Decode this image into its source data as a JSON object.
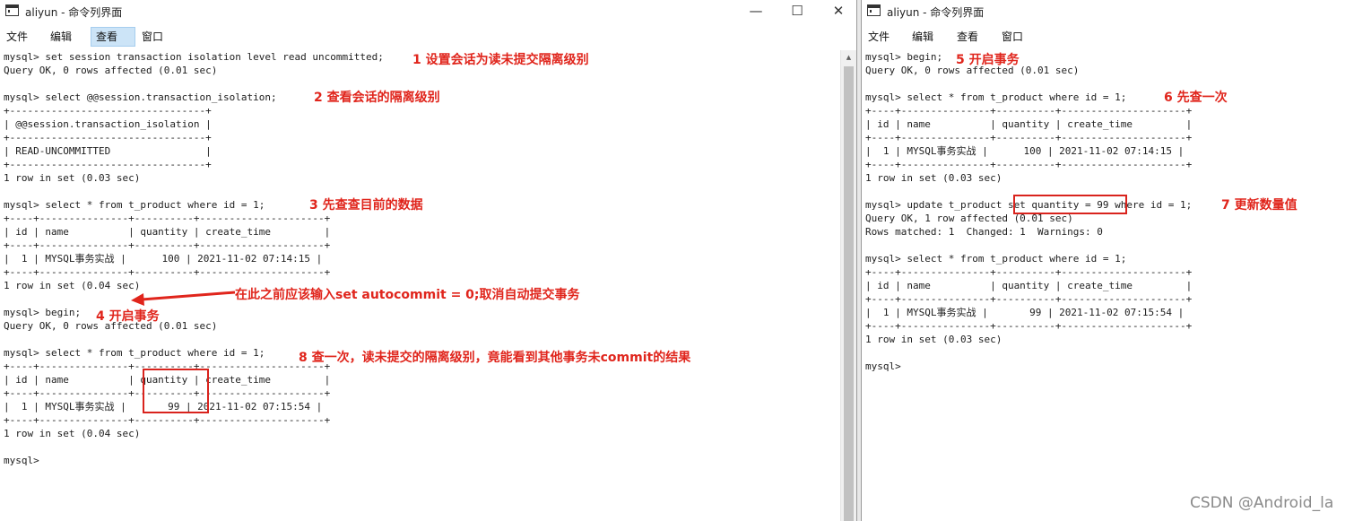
{
  "left_window": {
    "title": "aliyun - 命令列界面",
    "menu": [
      "文件",
      "编辑",
      "查看",
      "窗口"
    ],
    "active_menu_index": 2,
    "window_controls": [
      "—",
      "☐",
      "✕"
    ],
    "lines": [
      "mysql> set session transaction isolation level read uncommitted;",
      "Query OK, 0 rows affected (0.01 sec)",
      "",
      "mysql> select @@session.transaction_isolation;",
      "+---------------------------------+",
      "| @@session.transaction_isolation |",
      "+---------------------------------+",
      "| READ-UNCOMMITTED                |",
      "+---------------------------------+",
      "1 row in set (0.03 sec)",
      "",
      "mysql> select * from t_product where id = 1;",
      "+----+---------------+----------+---------------------+",
      "| id | name          | quantity | create_time         |",
      "+----+---------------+----------+---------------------+",
      "|  1 | MYSQL事务实战 |      100 | 2021-11-02 07:14:15 |",
      "+----+---------------+----------+---------------------+",
      "1 row in set (0.04 sec)",
      "",
      "mysql> begin;",
      "Query OK, 0 rows affected (0.01 sec)",
      "",
      "mysql> select * from t_product where id = 1;",
      "+----+---------------+----------+---------------------+",
      "| id | name          | quantity | create_time         |",
      "+----+---------------+----------+---------------------+",
      "|  1 | MYSQL事务实战 |       99 | 2021-11-02 07:15:54 |",
      "+----+---------------+----------+---------------------+",
      "1 row in set (0.04 sec)",
      "",
      "mysql>"
    ],
    "annotations": [
      "1 设置会话为读未提交隔离级别",
      "2 查看会话的隔离级别",
      "3 先查查目前的数据",
      "在此之前应该输入set autocommit = 0;取消自动提交事务",
      "4 开启事务",
      "8 查一次，读未提交的隔离级别，竟能看到其他事务未commit的结果"
    ]
  },
  "right_window": {
    "title": "aliyun - 命令列界面",
    "menu": [
      "文件",
      "编辑",
      "查看",
      "窗口"
    ],
    "lines": [
      "mysql> begin;",
      "Query OK, 0 rows affected (0.01 sec)",
      "",
      "mysql> select * from t_product where id = 1;",
      "+----+---------------+----------+---------------------+",
      "| id | name          | quantity | create_time         |",
      "+----+---------------+----------+---------------------+",
      "|  1 | MYSQL事务实战 |      100 | 2021-11-02 07:14:15 |",
      "+----+---------------+----------+---------------------+",
      "1 row in set (0.03 sec)",
      "",
      "mysql> update t_product set quantity = 99 where id = 1;",
      "Query OK, 1 row affected (0.01 sec)",
      "Rows matched: 1  Changed: 1  Warnings: 0",
      "",
      "mysql> select * from t_product where id = 1;",
      "+----+---------------+----------+---------------------+",
      "| id | name          | quantity | create_time         |",
      "+----+---------------+----------+---------------------+",
      "|  1 | MYSQL事务实战 |       99 | 2021-11-02 07:15:54 |",
      "+----+---------------+----------+---------------------+",
      "1 row in set (0.03 sec)",
      "",
      "mysql>"
    ],
    "annotations": [
      "5 开启事务",
      "6 先查一次",
      "7 更新数量值"
    ]
  },
  "watermark": "CSDN @Android_la",
  "colors": {
    "annotation": "#e0251c",
    "highlight_box": "#d9231d",
    "menu_active": "#cce4f7"
  },
  "icons": {
    "window_icon": "console-window-icon",
    "scroll_up": "triangle-up-icon"
  }
}
